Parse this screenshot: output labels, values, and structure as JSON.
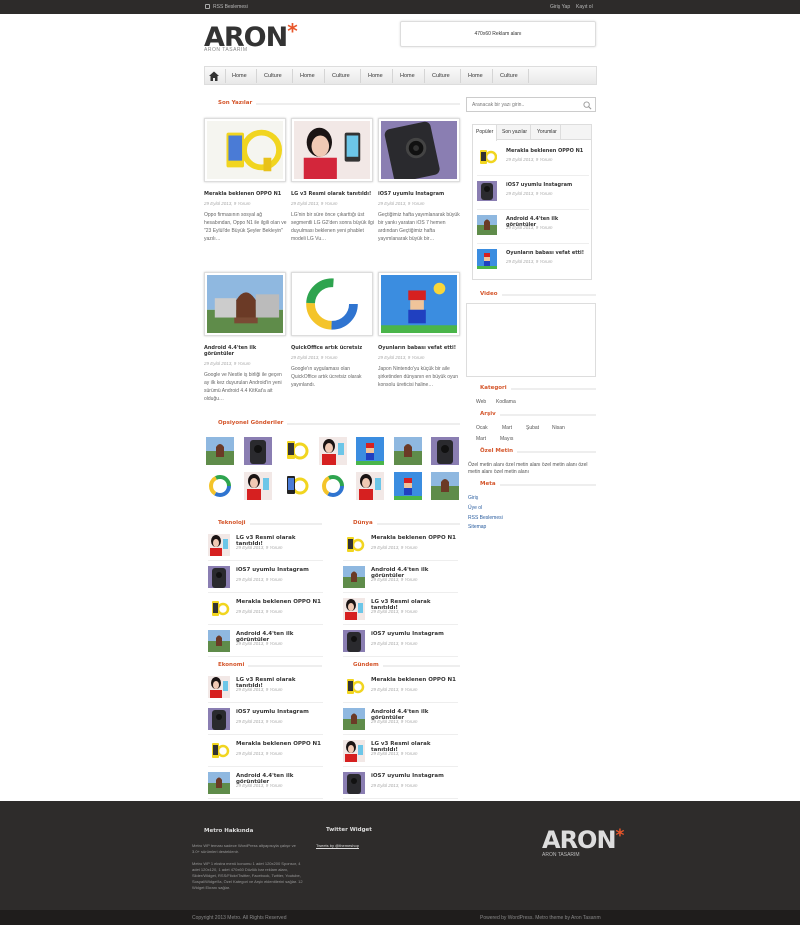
{
  "topbar": {
    "rss_label": "RSS Beslemesi",
    "login": "Giriş Yap",
    "register": "Kayıt ol"
  },
  "logo": {
    "title": "ARON",
    "asterisk": "*",
    "subtitle": "ARON TASARIM"
  },
  "ad": {
    "label": "470x60 Reklam alanı"
  },
  "nav": {
    "items": [
      "Home",
      "Culture",
      "Home",
      "Culture",
      "Home",
      "Home",
      "Culture",
      "Home",
      "Culture"
    ]
  },
  "sections": {
    "recent": "Son Yazılar",
    "optional": "Opsiyonel Gönderiler",
    "tech": "Teknoloji",
    "world": "Dünya",
    "economy": "Ekonomi",
    "agenda": "Gündem",
    "video": "Video",
    "category": "Kategori",
    "archive": "Arşiv",
    "special": "Özel Metin",
    "meta": "Meta"
  },
  "posts": [
    {
      "title": "Merakla beklenen OPPO N1",
      "meta": "29 Eylül 2013, 9 Yorum",
      "excerpt": "Oppo firmasının sosyal ağ hesabından, Oppo N1 ile ilgili olan ve \"23 Eylül'de Büyük Şeyler Bekleyin\" yazılı…"
    },
    {
      "title": "LG v3 Resmi olarak tanıtıldı!",
      "meta": "29 Eylül 2013, 9 Yorum",
      "excerpt": "LG'nin bir süre önce çıkarttığı üst segmentli LG G2'den sonra büyük ilgi duyulması beklenen yeni phablet modeli LG Vu…"
    },
    {
      "title": "iOS7 uyumlu Instagram",
      "meta": "29 Eylül 2013, 9 Yorum",
      "excerpt": "Geçtiğimiz hafta yayımlanarak büyük bir yankı yaratan iOS 7 hemen ardından Geçtiğimiz hafta yayımlanarak büyük bir…"
    },
    {
      "title": "Android 4.4'ten ilk görüntüler",
      "meta": "29 Eylül 2013, 9 Yorum",
      "excerpt": "Google ve Nestle iş birliği ile geçen ay ilk kez duyurulan Android'in yeni sürümü Android 4.4 KitKat'a ait olduğu…"
    },
    {
      "title": "QuickOffice artık ücretsiz",
      "meta": "29 Eylül 2013, 9 Yorum",
      "excerpt": "Google'ın uygulaması olan QuickOffice artık ücretsiz olarak yayınlandı."
    },
    {
      "title": "Oyunların babası vefat etti!",
      "meta": "29 Eylül 2013, 9 Yorum",
      "excerpt": "Japon Nintendo'yu küçük bir aile şirketinden dünyanın en büyük oyun konsolu üreticisi haline…"
    }
  ],
  "small": {
    "tech": [
      {
        "title": "LG v3 Resmi olarak tanıtıldı!",
        "meta": "29 Eylül 2013, 9 Yorum"
      },
      {
        "title": "iOS7 uyumlu Instagram",
        "meta": "29 Eylül 2013, 9 Yorum"
      },
      {
        "title": "Merakla beklenen OPPO N1",
        "meta": "29 Eylül 2013, 9 Yorum"
      },
      {
        "title": "Android 4.4'ten ilk görüntüler",
        "meta": "29 Eylül 2013, 9 Yorum"
      }
    ],
    "world": [
      {
        "title": "Merakla beklenen OPPO N1",
        "meta": "29 Eylül 2013, 9 Yorum"
      },
      {
        "title": "Android 4.4'ten ilk görüntüler",
        "meta": "29 Eylül 2013, 9 Yorum"
      },
      {
        "title": "LG v3 Resmi olarak tanıtıldı!",
        "meta": "29 Eylül 2013, 9 Yorum"
      },
      {
        "title": "iOS7 uyumlu Instagram",
        "meta": "29 Eylül 2013, 9 Yorum"
      }
    ],
    "economy": [
      {
        "title": "LG v3 Resmi olarak tanıtıldı!",
        "meta": "29 Eylül 2013, 9 Yorum"
      },
      {
        "title": "iOS7 uyumlu Instagram",
        "meta": "29 Eylül 2013, 9 Yorum"
      },
      {
        "title": "Merakla beklenen OPPO N1",
        "meta": "29 Eylül 2013, 9 Yorum"
      },
      {
        "title": "Android 4.4'ten ilk görüntüler",
        "meta": "29 Eylül 2013, 9 Yorum"
      }
    ],
    "agenda": [
      {
        "title": "Merakla beklenen OPPO N1",
        "meta": "29 Eylül 2013, 9 Yorum"
      },
      {
        "title": "Android 4.4'ten ilk görüntüler",
        "meta": "29 Eylül 2013, 9 Yorum"
      },
      {
        "title": "LG v3 Resmi olarak tanıtıldı!",
        "meta": "29 Eylül 2013, 9 Yorum"
      },
      {
        "title": "iOS7 uyumlu Instagram",
        "meta": "29 Eylül 2013, 9 Yorum"
      }
    ]
  },
  "search": {
    "placeholder": "Aranacak bir yazı girin.."
  },
  "tabs": {
    "labels": [
      "Popüler",
      "Son yazılar",
      "Yorumlar"
    ],
    "items": [
      {
        "title": "Merakla beklenen OPPO N1",
        "meta": "29 Eylül 2013, 9 Yorum"
      },
      {
        "title": "iOS7 uyumlu Instagram",
        "meta": "29 Eylül 2013, 9 Yorum"
      },
      {
        "title": "Android 4.4'ten ilk görüntüler",
        "meta": "29 Eylül 2013, 9 Yorum"
      },
      {
        "title": "Oyunların babası vefat etti!",
        "meta": "29 Eylül 2013, 9 Yorum"
      }
    ]
  },
  "category": {
    "items": [
      "Web",
      "Kodlama"
    ]
  },
  "archive": {
    "items": [
      "Ocak",
      "Mart",
      "Şubat",
      "Nisan",
      "Mart",
      "Mayıs"
    ]
  },
  "special": {
    "text": "Özel metin alanı özel metin alanı özel metin alanı özel metin alanı özel metin alanı"
  },
  "meta": {
    "items": [
      "Giriş",
      "Üye ol",
      "RSS Beslemesi",
      "Sitemap"
    ]
  },
  "footer": {
    "about_title": "Metro Hakkında",
    "about_p1": "Metro WP teması sadece WordPress altyapısıyla çalışır ve 3.0+ sürümleri desteklenir.",
    "about_p2": "Metro WP 1 ekstra menü konumu 1 adet 120x200 Sponsor, 4 adet 120x120, 1 adet 470x60 Düzlük bar reklam alanı, Slider/Widget, RSS/Flickr/Twitter, Facebook, Twitter, Youtube, Sosyal/Widget'la, Özel Kategori ve Arşiv eklentilerini sağlar. 12 Widget Ekranı sağlar.",
    "twitter_title": "Twitter Widget",
    "twitter_link": "Tweets by @themeshop",
    "copyright": "Copyright 2013 Metro. All Rights Reserved",
    "powered": "Powered by WordPress. Metro theme by Aron Tasarım"
  }
}
